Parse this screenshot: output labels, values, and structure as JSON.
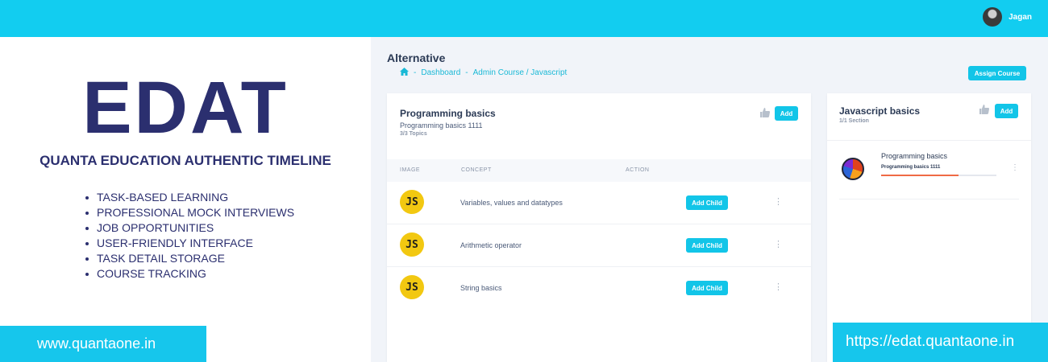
{
  "header": {
    "user_name": "Jagan",
    "accent_color": "#12cdf0"
  },
  "promo": {
    "brand": "EDAT",
    "tagline": "QUANTA EDUCATION AUTHENTIC TIMELINE",
    "features": [
      "TASK-BASED LEARNING",
      "PROFESSIONAL MOCK INTERVIEWS",
      "JOB OPPORTUNITIES",
      "USER-FRIENDLY INTERFACE",
      "TASK DETAIL STORAGE",
      "COURSE TRACKING"
    ],
    "url_left": "www.quantaone.in",
    "url_right": "https://edat.quantaone.in"
  },
  "page": {
    "title": "Alternative",
    "breadcrumb": {
      "sep": "-",
      "dashboard": "Dashboard",
      "current": "Admin Course / Javascript"
    },
    "assign_label": "Assign Course"
  },
  "main_card": {
    "title": "Programming basics",
    "subtitle": "Programming basics 1111",
    "meta": "3/3 Topics",
    "add_label": "Add",
    "columns": [
      "IMAGE",
      "CONCEPT",
      "ACTION"
    ],
    "rows": [
      {
        "icon_text": "JS",
        "concept": "Variables, values and datatypes",
        "action_label": "Add Child",
        "more": "⋮"
      },
      {
        "icon_text": "JS",
        "concept": "Arithmetic operator",
        "action_label": "Add Child",
        "more": "⋮"
      },
      {
        "icon_text": "JS",
        "concept": "String basics",
        "action_label": "Add Child",
        "more": "⋮"
      }
    ]
  },
  "side_card": {
    "title": "Javascript basics",
    "meta": "1/1 Section",
    "add_label": "Add",
    "course": {
      "title": "Programming basics",
      "subtitle": "Programming basics 1111",
      "progress": 0.67,
      "more": "⋮"
    }
  }
}
